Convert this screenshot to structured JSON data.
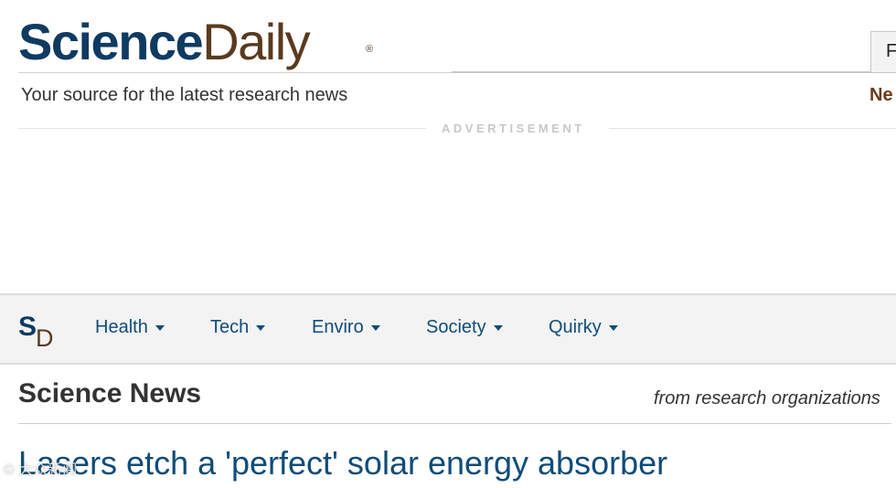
{
  "header": {
    "logo_science": "Science",
    "logo_daily": "Daily",
    "logo_reg": "®",
    "tagline": "Your source for the latest research news",
    "search_partial": "F",
    "top_link_partial": "Ne"
  },
  "ad": {
    "label": "ADVERTISEMENT"
  },
  "nav": {
    "mark_s": "S",
    "mark_d": "D",
    "items": [
      {
        "label": "Health"
      },
      {
        "label": "Tech"
      },
      {
        "label": "Enviro"
      },
      {
        "label": "Society"
      },
      {
        "label": "Quirky"
      }
    ]
  },
  "section": {
    "title": "Science News",
    "subtitle": "from research organizations"
  },
  "article": {
    "headline": "Lasers etch a 'perfect' solar energy absorber"
  },
  "watermark": {
    "text": "© 大众新闻"
  },
  "colors": {
    "brand_blue": "#0f3b62",
    "brand_brown": "#5a3a1e",
    "link_blue": "#0f4c7a",
    "nav_bg": "#f3f3f3"
  }
}
